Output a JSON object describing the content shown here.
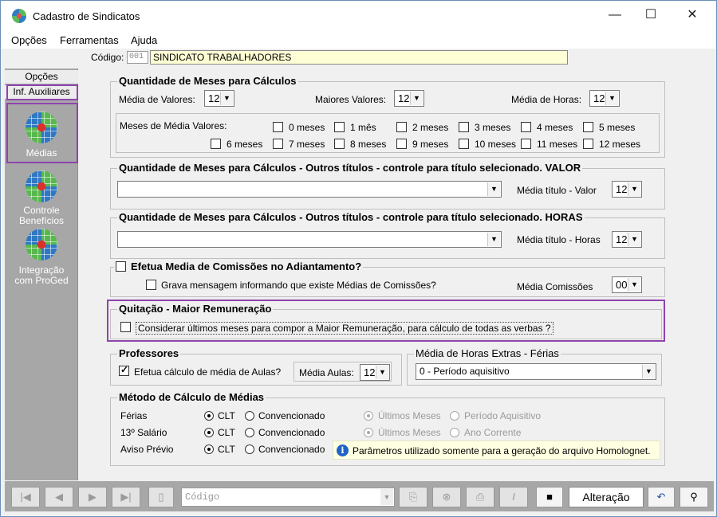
{
  "window": {
    "title": "Cadastro de Sindicatos",
    "minimize": "—",
    "maximize": "☐",
    "close": "✕"
  },
  "menu": [
    "Opções",
    "Ferramentas",
    "Ajuda"
  ],
  "code": {
    "label": "Código:",
    "number": "001",
    "name": "SINDICATO TRABALHADORES"
  },
  "sidebar": {
    "tabs": [
      "Opções",
      "Inf. Auxiliares"
    ],
    "buttons": [
      {
        "label": "Médias",
        "icon": "grid-globe-icon"
      },
      {
        "label": "Controle Benefícios",
        "icon": "grid-globe-icon"
      },
      {
        "label": "Integração com ProGed",
        "icon": "grid-globe-icon"
      }
    ]
  },
  "meses": {
    "title": "Quantidade de Meses para Cálculos",
    "media_valores_label": "Média de Valores:",
    "media_valores": "12",
    "maiores_valores_label": "Maiores Valores:",
    "maiores_valores": "12",
    "media_horas_label": "Média de Horas:",
    "media_horas": "12",
    "meses_media_label": "Meses de Média Valores:",
    "options": [
      {
        "label": "0 meses",
        "checked": false
      },
      {
        "label": "1 mês",
        "checked": false
      },
      {
        "label": "2 meses",
        "checked": false
      },
      {
        "label": "3 meses",
        "checked": false
      },
      {
        "label": "4 meses",
        "checked": false
      },
      {
        "label": "5 meses",
        "checked": false
      },
      {
        "label": "6 meses",
        "checked": false
      },
      {
        "label": "7 meses",
        "checked": false
      },
      {
        "label": "8 meses",
        "checked": false
      },
      {
        "label": "9 meses",
        "checked": false
      },
      {
        "label": "10 meses",
        "checked": false
      },
      {
        "label": "11 meses",
        "checked": false
      },
      {
        "label": "12 meses",
        "checked": false
      }
    ]
  },
  "outros_valor": {
    "title": "Quantidade de Meses para Cálculos - Outros títulos - controle para título selecionado. VALOR",
    "combo": "",
    "media_label": "Média título - Valor",
    "media": "12"
  },
  "outros_horas": {
    "title": "Quantidade de Meses para Cálculos - Outros títulos - controle para título selecionado. HORAS",
    "combo": "",
    "media_label": "Média título - Horas",
    "media": "12"
  },
  "comissoes": {
    "title": "Efetua Media de Comissões no Adiantamento?",
    "grava_label": "Grava mensagem informando que existe Médias de Comissões?",
    "media_label": "Média Comissões",
    "media": "00"
  },
  "quitacao": {
    "title": "Quitação - Maior Remuneração",
    "option": "Considerar últimos meses para compor a Maior Remuneração, para cálculo de todas as verbas ?"
  },
  "professores": {
    "title": "Professores",
    "option": "Efetua cálculo de média de Aulas?",
    "media_label": "Média Aulas:",
    "media": "12"
  },
  "horas_extras": {
    "title": "Média de Horas Extras - Férias",
    "value": "0 - Período aquisitivo"
  },
  "metodo": {
    "title": "Método de Cálculo de Médias",
    "rows": [
      {
        "label": "Férias",
        "opt1": "CLT",
        "opt2": "Convencionado",
        "opt3": "Últimos Meses",
        "opt4": "Período Aquisitivo"
      },
      {
        "label": "13º Salário",
        "opt1": "CLT",
        "opt2": "Convencionado",
        "opt3": "Últimos Meses",
        "opt4": "Ano Corrente"
      },
      {
        "label": "Aviso Prévio",
        "opt1": "CLT",
        "opt2": "Convencionado"
      }
    ],
    "info": "Parâmetros utilizado somente para a geração do arquivo Homolognet."
  },
  "toolbar": {
    "search_placeholder": "Código",
    "status": "Alteração",
    "icons": [
      "first-icon",
      "prev-icon",
      "next-icon",
      "last-icon",
      "new-doc-icon",
      "find-doc-icon",
      "delete-icon",
      "print-icon",
      "edit-icon",
      "save-icon",
      "undo-icon",
      "search-binoculars-icon"
    ]
  },
  "colors": {
    "highlight": "#8e44ad",
    "sidebar": "#a7a7a7",
    "code_field": "#ffffd5"
  }
}
